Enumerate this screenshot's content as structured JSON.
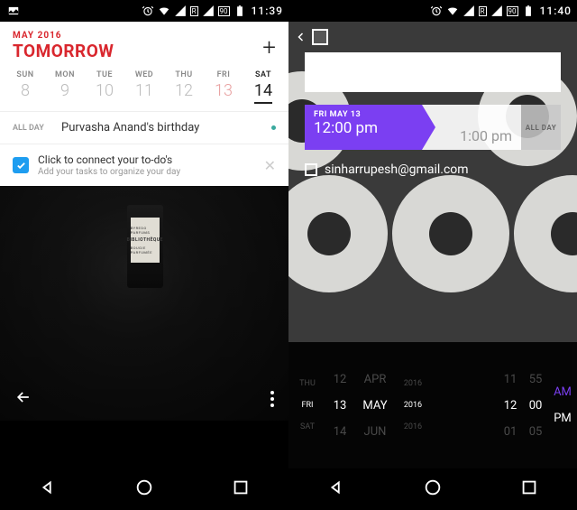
{
  "left": {
    "status_time": "11:39",
    "month_label": "MAY 2016",
    "day_label": "TOMORROW",
    "week": [
      {
        "name": "SUN",
        "num": "8"
      },
      {
        "name": "MON",
        "num": "9"
      },
      {
        "name": "TUE",
        "num": "10"
      },
      {
        "name": "WED",
        "num": "11"
      },
      {
        "name": "THU",
        "num": "12"
      },
      {
        "name": "FRI",
        "num": "13"
      },
      {
        "name": "SAT",
        "num": "14"
      }
    ],
    "allday_label": "ALL DAY",
    "event_title": "Purvasha Anand's birthday",
    "todo_title": "Click to connect your to-do's",
    "todo_subtitle": "Add your tasks to organize your day",
    "bottle_brand": "BYREDO PARFUMS",
    "bottle_name": "BIBLIOTHÈQUE",
    "bottle_sub": "BOUGIE PARFUMÉE"
  },
  "right": {
    "status_time": "11:40",
    "start_date": "FRI MAY 13",
    "start_time": "12:00 pm",
    "end_time": "1:00 pm",
    "allday_btn": "ALL DAY",
    "email": "sinharrupesh@gmail.com",
    "picker": {
      "dow": [
        "THU",
        "FRI",
        "SAT"
      ],
      "day": [
        "12",
        "13",
        "14"
      ],
      "month": [
        "APR",
        "MAY",
        "JUN"
      ],
      "year": [
        "2016",
        "2016",
        "2016"
      ],
      "hour": [
        "11",
        "12",
        "01"
      ],
      "min": [
        "55",
        "00",
        "05"
      ],
      "ampm": [
        "AM",
        "PM"
      ]
    }
  }
}
